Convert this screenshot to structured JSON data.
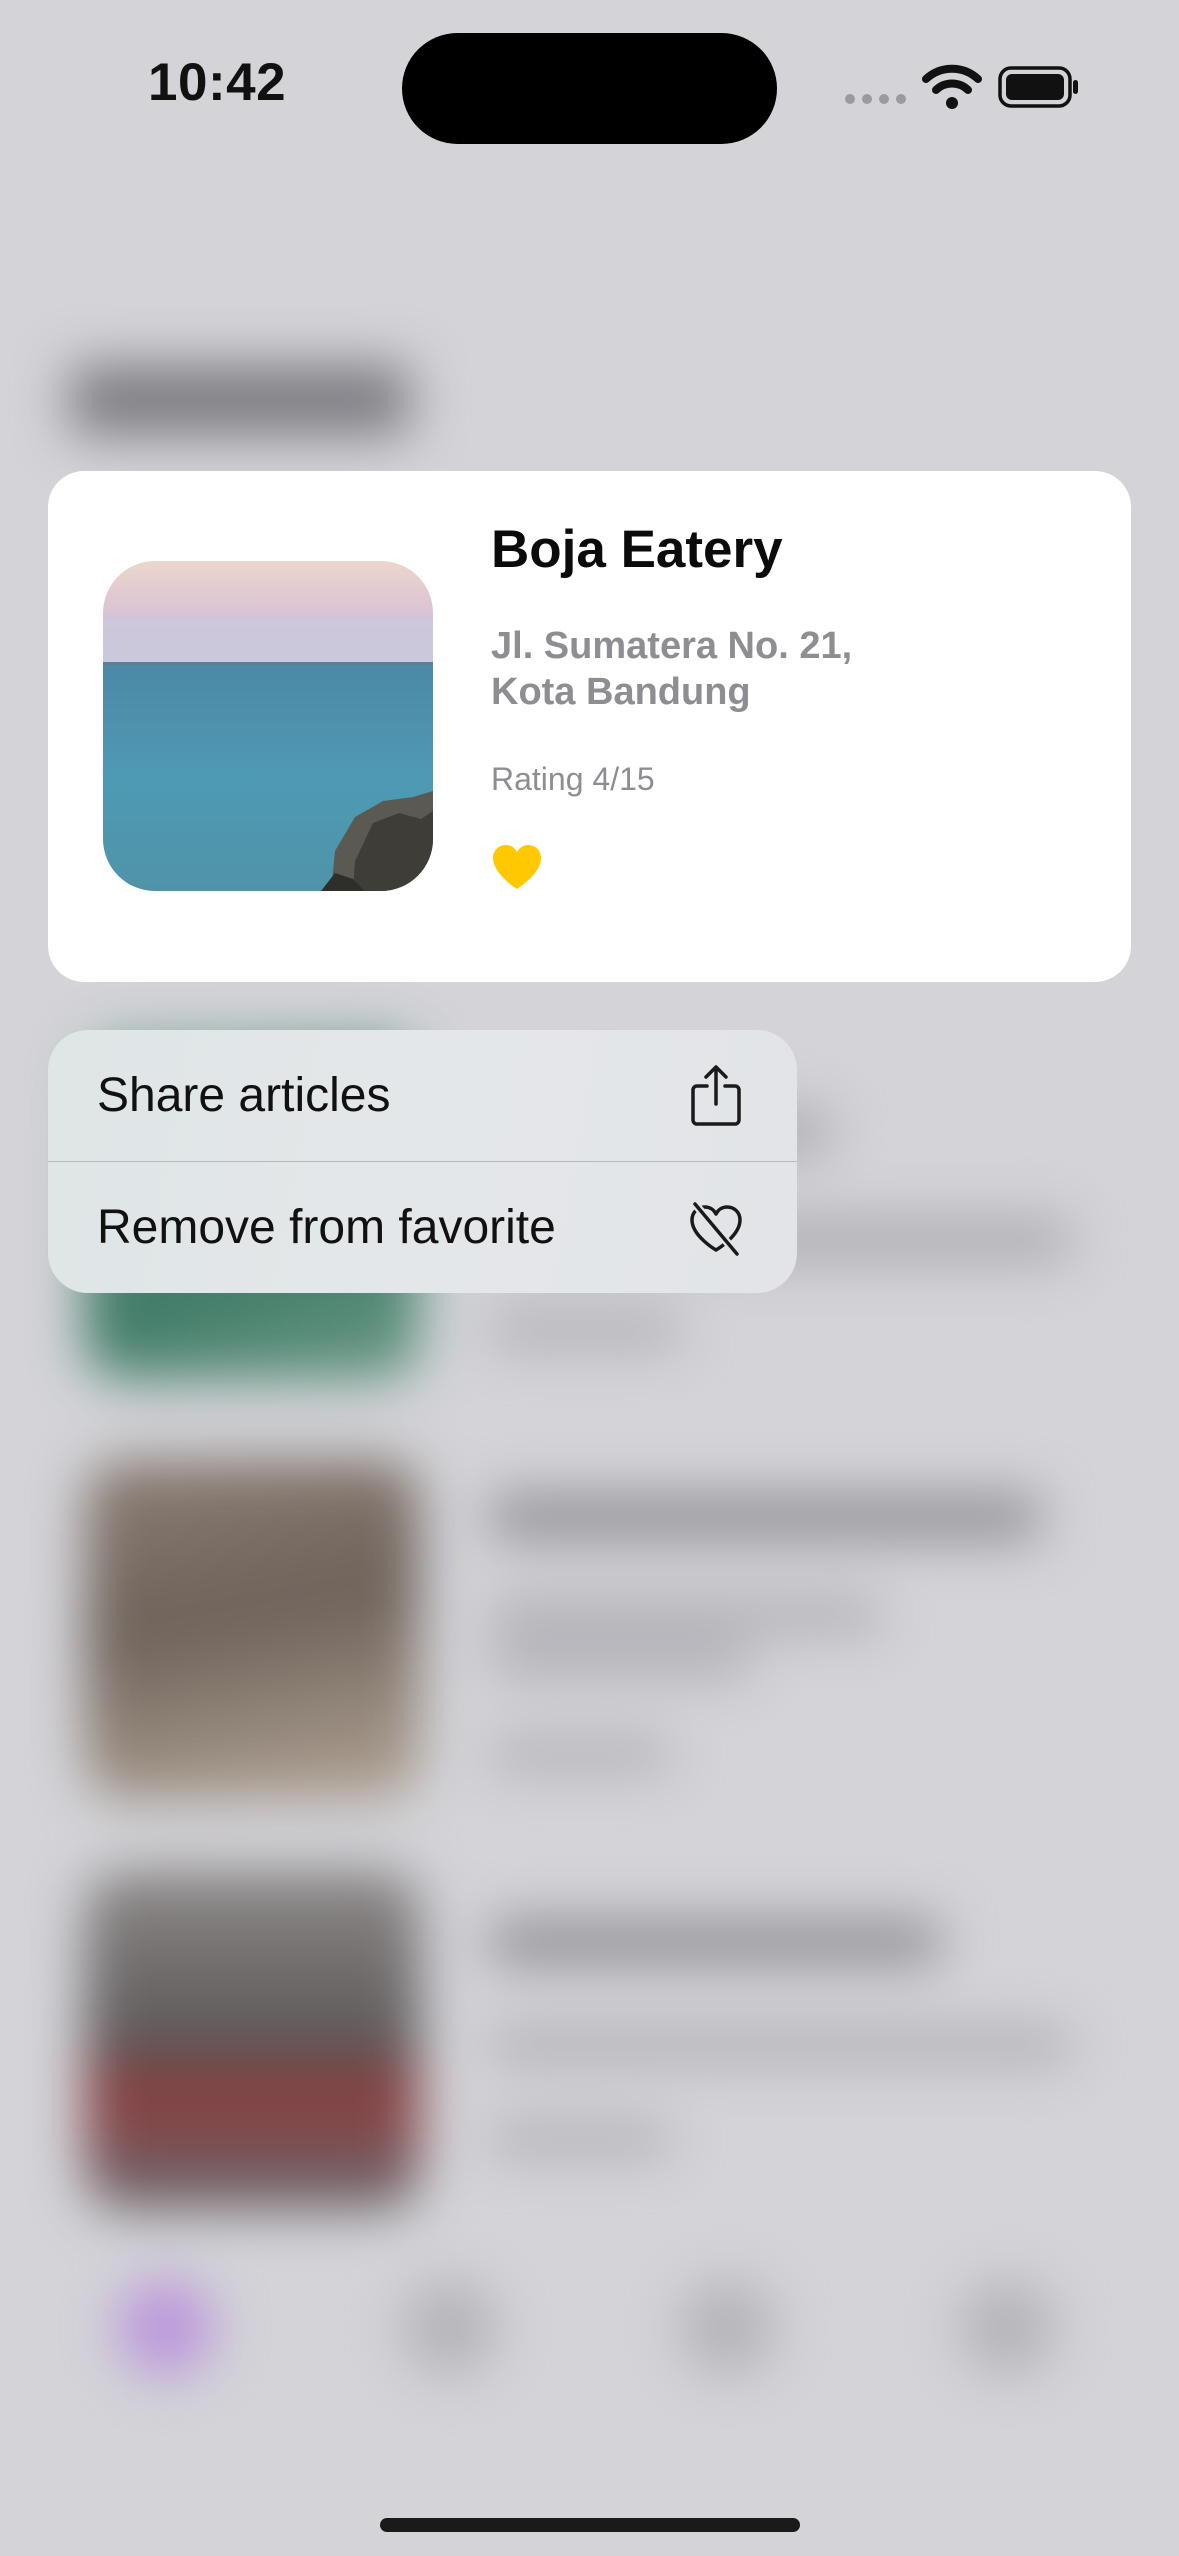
{
  "status_bar": {
    "time": "10:42"
  },
  "background": {
    "screen_title_blurred": true
  },
  "preview_card": {
    "title": "Boja Eatery",
    "address_line1": "Jl. Sumatera No. 21,",
    "address_line2": "Kota Bandung",
    "rating": "Rating 4/15",
    "favorite": true,
    "heart_color": "#FFC800"
  },
  "context_menu": {
    "items": [
      {
        "label": "Share articles",
        "icon": "share-icon"
      },
      {
        "label": "Remove from favorite",
        "icon": "heart-slash-icon"
      }
    ]
  },
  "colors": {
    "accent_tab": "#BB95DB",
    "menu_background": "#E2E6E8"
  }
}
